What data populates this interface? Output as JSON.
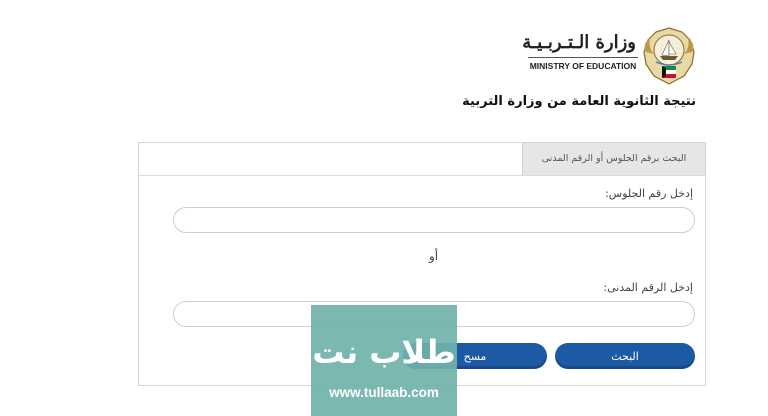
{
  "header": {
    "ministry_name_ar": "وزارة الـتـربـيـة",
    "ministry_name_en": "MINISTRY OF EDUCATION",
    "emblem_icon": "kuwait-emblem-icon"
  },
  "page": {
    "title": "نتيجة الثانوية العامة من وزارة التربية"
  },
  "panel": {
    "tab_label": "البحث برقم الجلوس أو الرقم المدنى",
    "seat_label": "إدخل رقم الجلوس:",
    "seat_value": "",
    "or_label": "أو",
    "civil_label": "إدخل الرقم المدنى:",
    "civil_value": "",
    "search_button": "البحث",
    "clear_button": "مسح"
  },
  "watermark": {
    "logo_text": "طلاب نت",
    "url": "www.tullaab.com"
  },
  "colors": {
    "button_blue": "#1c5aa5",
    "watermark_teal": "#70b2aa"
  }
}
